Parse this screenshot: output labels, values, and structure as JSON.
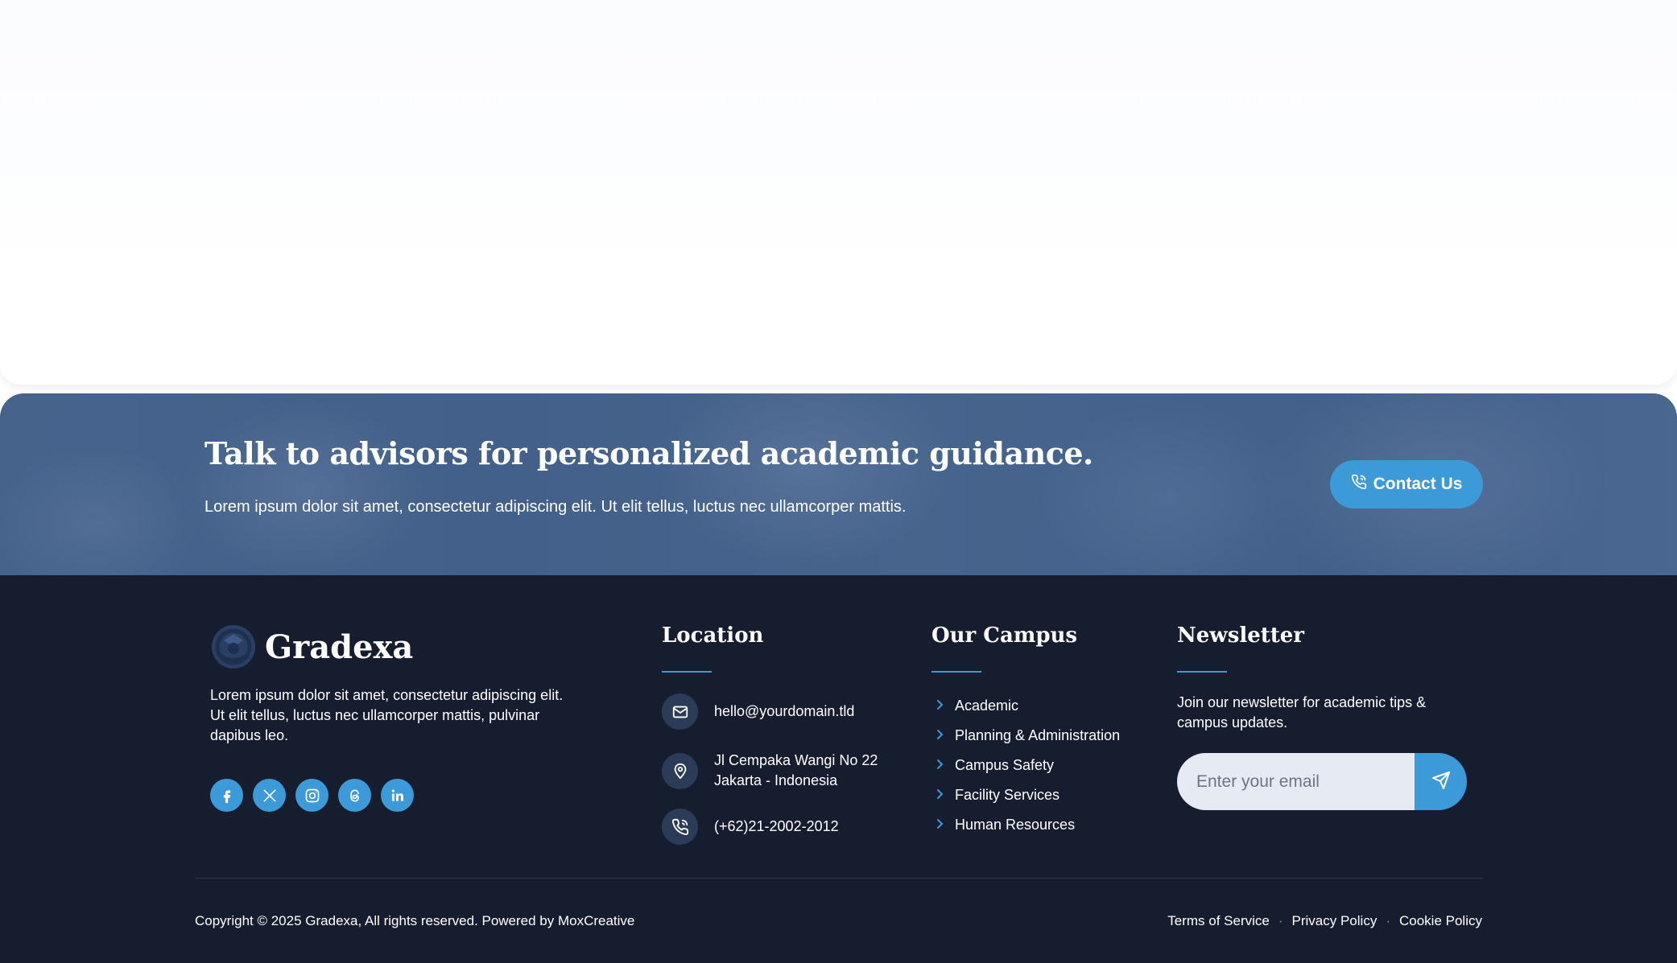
{
  "cta": {
    "title": "Talk to advisors for personalized academic guidance.",
    "description": "Lorem ipsum dolor sit amet, consectetur adipiscing elit. Ut elit tellus, luctus nec ullamcorper mattis.",
    "button_label": "Contact Us",
    "button_icon": "phone-icon"
  },
  "brand": {
    "name": "Gradexa",
    "description": "Lorem ipsum dolor sit amet, consectetur adipiscing elit. Ut elit tellus, luctus nec ullamcorper mattis, pulvinar dapibus leo.",
    "socials": [
      "facebook-icon",
      "x-icon",
      "instagram-icon",
      "threads-icon",
      "linkedin-icon"
    ]
  },
  "location": {
    "title": "Location",
    "email": "hello@yourdomain.tld",
    "address_line1": "Jl Cempaka Wangi No 22",
    "address_line2": "Jakarta - Indonesia",
    "phone": "(+62)21-2002-2012"
  },
  "campus": {
    "title": "Our Campus",
    "items": [
      "Academic",
      "Planning & Administration",
      "Campus Safety",
      "Facility Services",
      "Human Resources"
    ]
  },
  "newsletter": {
    "title": "Newsletter",
    "description": "Join our newsletter for academic tips & campus updates.",
    "placeholder": "Enter your email",
    "submit_icon": "send-icon"
  },
  "bottom": {
    "copyright": "Copyright © 2025 Gradexa, All rights reserved. Powered by MoxCreative",
    "links": [
      "Terms of Service",
      "Privacy Policy",
      "Cookie Policy"
    ],
    "separator": "·"
  },
  "colors": {
    "accent": "#3d9ad8",
    "footer_bg": "#161d2e",
    "cta_bg": "#4f6b93"
  }
}
